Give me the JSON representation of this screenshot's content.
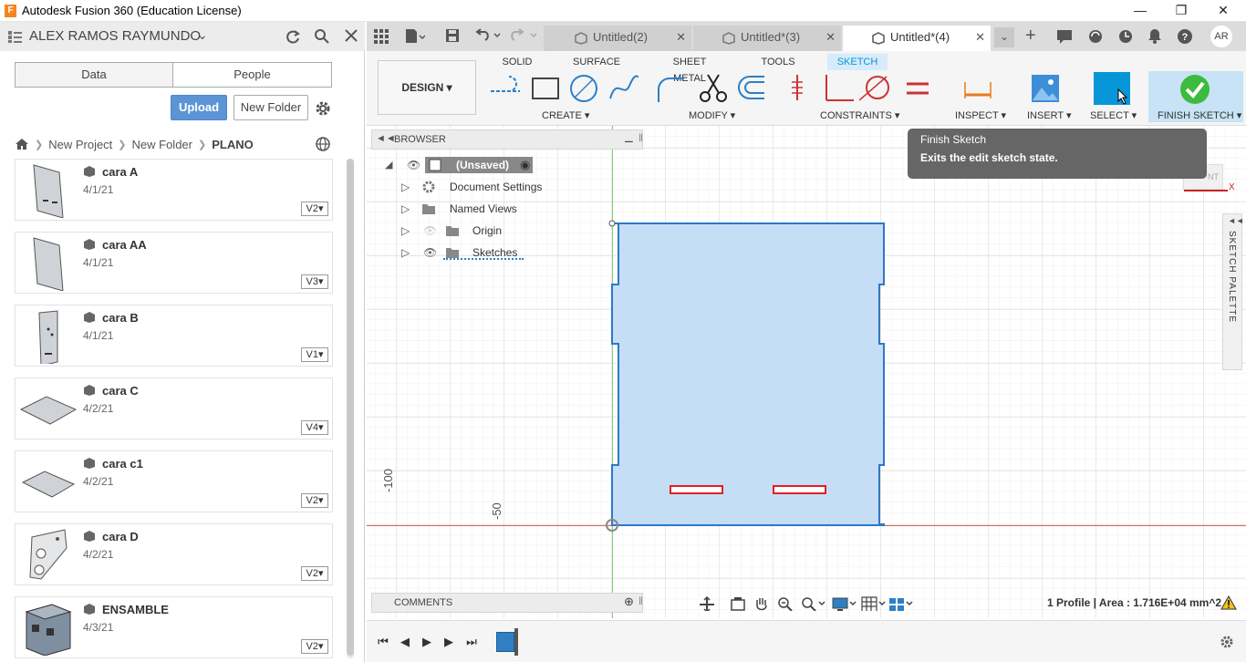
{
  "window": {
    "title": "Autodesk Fusion 360 (Education License)",
    "logo_letter": "F"
  },
  "data_panel": {
    "user": "ALEX RAMOS RAYMUNDO",
    "tabs": [
      "Data",
      "People"
    ],
    "upload_label": "Upload",
    "new_folder_label": "New Folder",
    "breadcrumb": [
      "New Project",
      "New Folder",
      "PLANO"
    ],
    "files": [
      {
        "name": "cara A",
        "date": "4/1/21",
        "version": "V2"
      },
      {
        "name": "cara AA",
        "date": "4/1/21",
        "version": "V3"
      },
      {
        "name": "cara B",
        "date": "4/1/21",
        "version": "V1"
      },
      {
        "name": "cara C",
        "date": "4/2/21",
        "version": "V4"
      },
      {
        "name": "cara c1",
        "date": "4/2/21",
        "version": "V2"
      },
      {
        "name": "cara D",
        "date": "4/2/21",
        "version": "V2"
      },
      {
        "name": "ENSAMBLE",
        "date": "4/3/21",
        "version": "V2"
      }
    ]
  },
  "doc_tabs": [
    "Untitled(2)",
    "Untitled*(3)",
    "Untitled*(4)"
  ],
  "user_initials": "AR",
  "toolbar": {
    "workspace": "DESIGN",
    "tabs": [
      "SOLID",
      "SURFACE",
      "SHEET METAL",
      "TOOLS",
      "SKETCH"
    ],
    "groups": [
      "CREATE",
      "MODIFY",
      "CONSTRAINTS",
      "INSPECT",
      "INSERT",
      "SELECT",
      "FINISH SKETCH"
    ]
  },
  "browser": {
    "title": "BROWSER",
    "root": "(Unsaved)",
    "items": [
      "Document Settings",
      "Named Views",
      "Origin",
      "Sketches"
    ]
  },
  "tooltip": {
    "title": "Finish Sketch",
    "body": "Exits the edit sketch state."
  },
  "sketch_palette_label": "SKETCH PALETTE",
  "comments_label": "COMMENTS",
  "status": "1 Profile | Area : 1.716E+04 mm^2",
  "axis_labels": [
    "-100",
    "-50"
  ],
  "viewcube_axis": "X",
  "viewcube_face": "NT",
  "colors": {
    "accent": "#0696d7",
    "profile_fill": "#c6ddf6",
    "finish_green": "#3dbb3f",
    "upload_blue": "#5b95d6"
  }
}
